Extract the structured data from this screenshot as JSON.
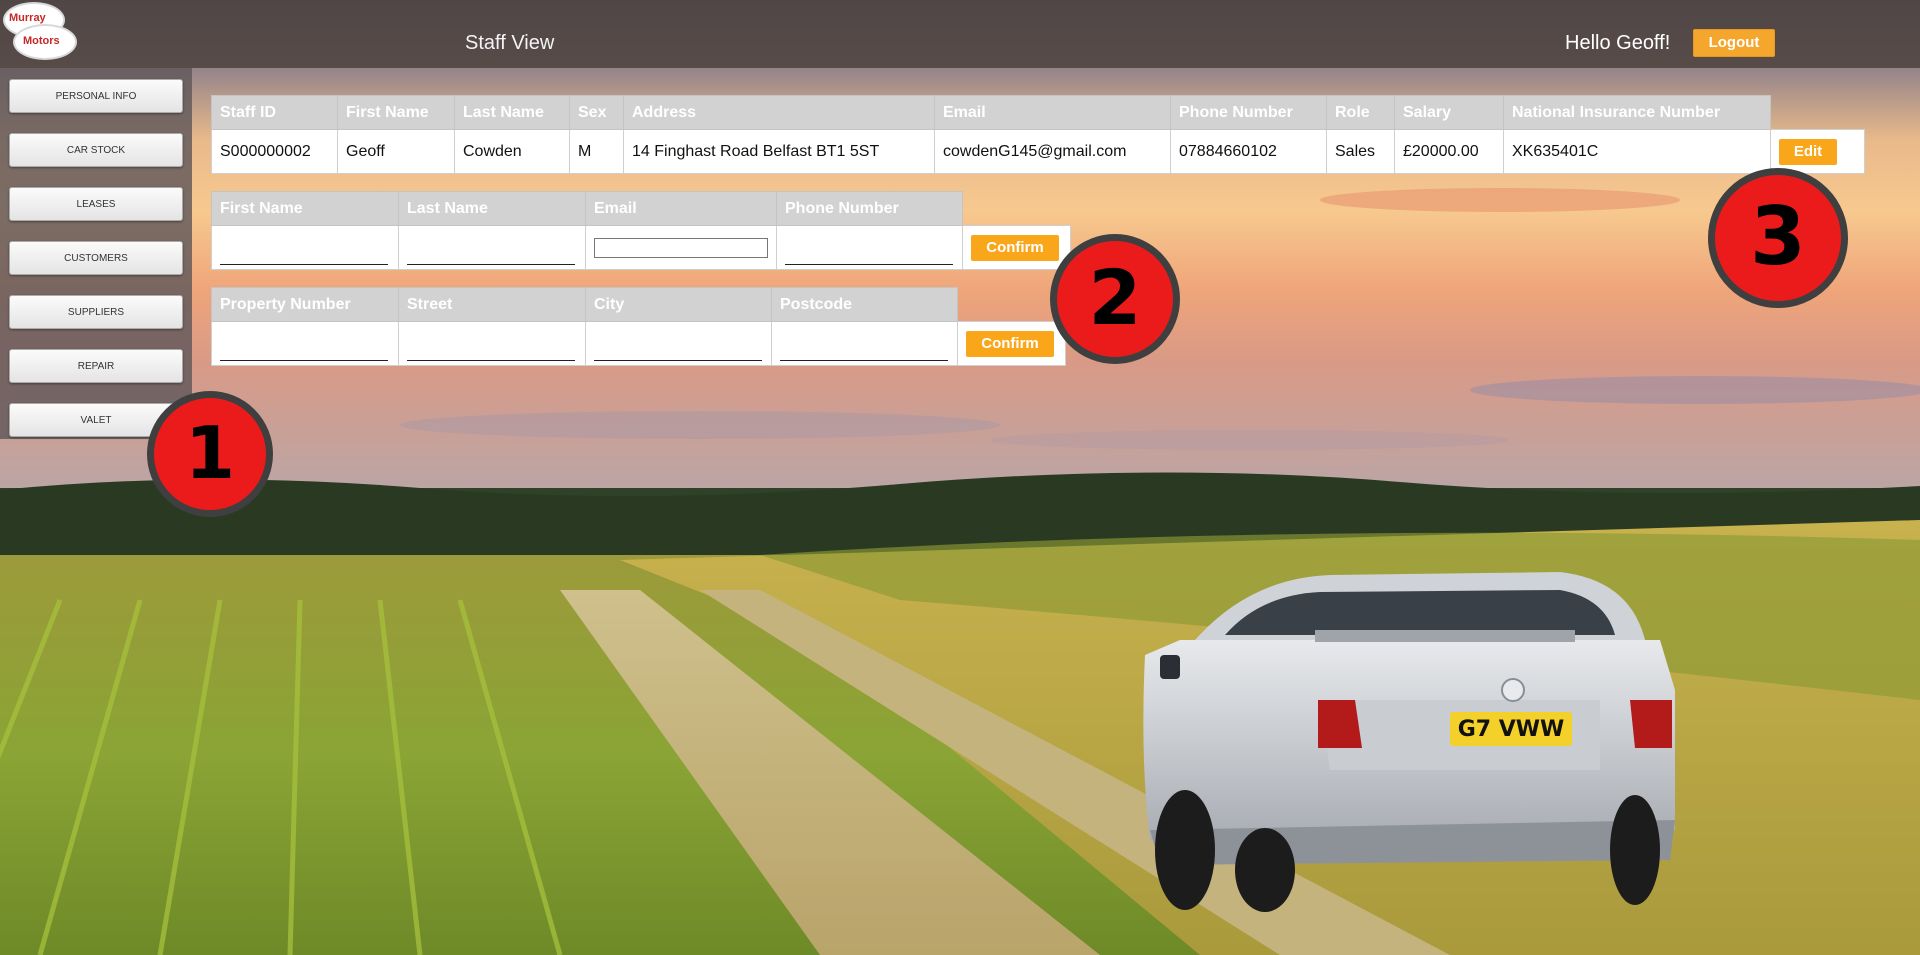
{
  "header": {
    "logo_word1": "Murray",
    "logo_word2": "Motors",
    "page_title": "Staff View",
    "greeting": "Hello Geoff!",
    "logout_label": "Logout"
  },
  "sidebar": {
    "items": [
      {
        "label": "PERSONAL INFO"
      },
      {
        "label": "CAR STOCK"
      },
      {
        "label": "LEASES"
      },
      {
        "label": "CUSTOMERS"
      },
      {
        "label": "SUPPLIERS"
      },
      {
        "label": "REPAIR"
      },
      {
        "label": "VALET"
      }
    ]
  },
  "staff_table": {
    "headers": [
      "Staff ID",
      "First Name",
      "Last Name",
      "Sex",
      "Address",
      "Email",
      "Phone Number",
      "Role",
      "Salary",
      "National Insurance Number"
    ],
    "row": [
      "S000000002",
      "Geoff",
      "Cowden",
      "M",
      "14 Finghast Road Belfast BT1 5ST",
      "cowdenG145@gmail.com",
      "07884660102",
      "Sales",
      "£20000.00",
      "XK635401C"
    ],
    "edit_label": "Edit"
  },
  "contact_form": {
    "headers": [
      "First Name",
      "Last Name",
      "Email",
      "Phone Number"
    ],
    "confirm_label": "Confirm"
  },
  "address_form": {
    "headers": [
      "Property Number",
      "Street",
      "City",
      "Postcode"
    ],
    "confirm_label": "Confirm"
  },
  "badges": [
    "1",
    "2",
    "3"
  ],
  "colors": {
    "accent": "#f9a61a",
    "header_bg": "#4e423e",
    "badge_red": "#ec1b1b",
    "table_header": "#d2d2d2"
  },
  "license_plate": "G7 VWW"
}
